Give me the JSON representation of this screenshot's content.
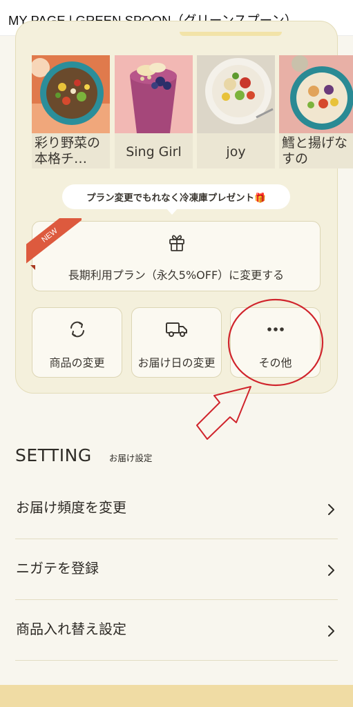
{
  "header": {
    "title": "MY PAGE | GREEN SPOON（グリーンスプーン）"
  },
  "products": [
    {
      "name": "彩り野菜の本格チ…"
    },
    {
      "name": "Sing Girl"
    },
    {
      "name": "joy"
    },
    {
      "name": "鱈と揚げなすの"
    }
  ],
  "promo": {
    "bubble_text": "プラン変更でもれなく冷凍庫プレゼント🎁",
    "badge": "NEW",
    "plan_change_label": "長期利用プラン（永久5%OFF）に変更する",
    "icon": "gift-icon"
  },
  "actions": [
    {
      "label": "商品の変更",
      "icon": "refresh-icon"
    },
    {
      "label": "お届け日の変更",
      "icon": "truck-icon"
    },
    {
      "label": "その他",
      "icon": "more-icon"
    }
  ],
  "annotation": {
    "color": "#d0242c"
  },
  "setting": {
    "title": "SETTING",
    "subtitle": "お届け設定",
    "items": [
      {
        "label": "お届け頻度を変更"
      },
      {
        "label": "ニガテを登録"
      },
      {
        "label": "商品入れ替え設定"
      }
    ]
  },
  "colors": {
    "background": "#f8f6ee",
    "card": "#f4f0dc",
    "new_badge": "#dd5a3e",
    "bottom_band": "#f0dca4"
  }
}
